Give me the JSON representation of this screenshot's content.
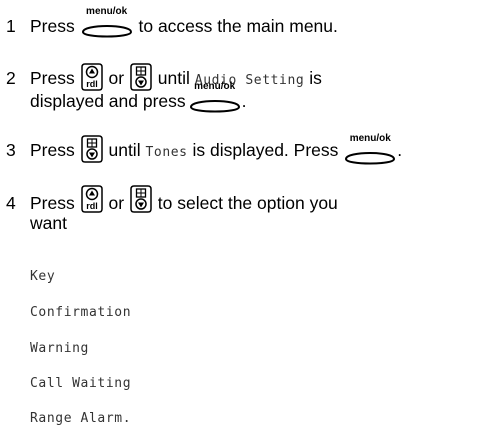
{
  "steps": [
    {
      "number": "1",
      "text_a": "Press",
      "button_label": "menu/ok",
      "text_b": "to access the main menu."
    },
    {
      "number": "2",
      "text_a": "Press",
      "text_or": "or",
      "text_until": "until",
      "lcd": "Audio Setting",
      "text_is": "is",
      "line2_text": "displayed and press",
      "button_label": "menu/ok",
      "end": "."
    },
    {
      "number": "3",
      "text_a": "Press",
      "text_until": "until",
      "lcd": "Tones",
      "text_b": "is displayed. Press",
      "button_label": "menu/ok",
      "end": "."
    },
    {
      "number": "4",
      "text_a": "Press",
      "text_or": "or",
      "text_b": "to select the option you",
      "line2_text": "want"
    }
  ],
  "options": [
    "Key",
    "Confirmation",
    "Warning",
    "Call Waiting",
    "Range Alarm."
  ]
}
